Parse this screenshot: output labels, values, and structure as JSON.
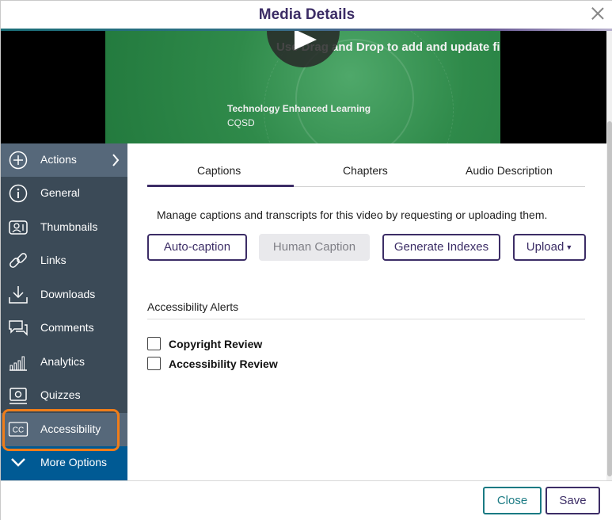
{
  "dialog": {
    "title": "Media Details"
  },
  "video": {
    "headline": "Use Drag and Drop to add and update files",
    "subtitle_line1": "Technology Enhanced Learning",
    "subtitle_line2": "CQSD"
  },
  "sidebar": {
    "items": [
      {
        "label": "Actions",
        "icon": "plus-circle-icon"
      },
      {
        "label": "General",
        "icon": "info-circle-icon"
      },
      {
        "label": "Thumbnails",
        "icon": "thumbnail-icon"
      },
      {
        "label": "Links",
        "icon": "link-icon"
      },
      {
        "label": "Downloads",
        "icon": "download-icon"
      },
      {
        "label": "Comments",
        "icon": "comments-icon"
      },
      {
        "label": "Analytics",
        "icon": "analytics-icon"
      },
      {
        "label": "Quizzes",
        "icon": "quiz-icon"
      },
      {
        "label": "Accessibility",
        "icon": "cc-icon",
        "icon_text": "CC"
      },
      {
        "label": "More Options",
        "icon": "chevron-down-icon"
      }
    ]
  },
  "tabs": [
    {
      "label": "Captions",
      "active": true
    },
    {
      "label": "Chapters"
    },
    {
      "label": "Audio Description"
    }
  ],
  "captions": {
    "description": "Manage captions and transcripts for this video by requesting or uploading them.",
    "buttons": {
      "auto_caption": "Auto-caption",
      "human_caption": "Human Caption",
      "generate_indexes": "Generate Indexes",
      "upload": "Upload"
    }
  },
  "alerts": {
    "title": "Accessibility Alerts",
    "items": [
      {
        "label": "Copyright Review",
        "checked": false
      },
      {
        "label": "Accessibility Review",
        "checked": false
      }
    ]
  },
  "footer": {
    "close_label": "Close",
    "save_label": "Save"
  },
  "colors": {
    "primary": "#3c2d66",
    "teal": "#1a7a83",
    "sidebar": "#3b4a57",
    "sidebar_selected": "#56687a",
    "more_options": "#005a94",
    "focus": "#f07d19"
  }
}
